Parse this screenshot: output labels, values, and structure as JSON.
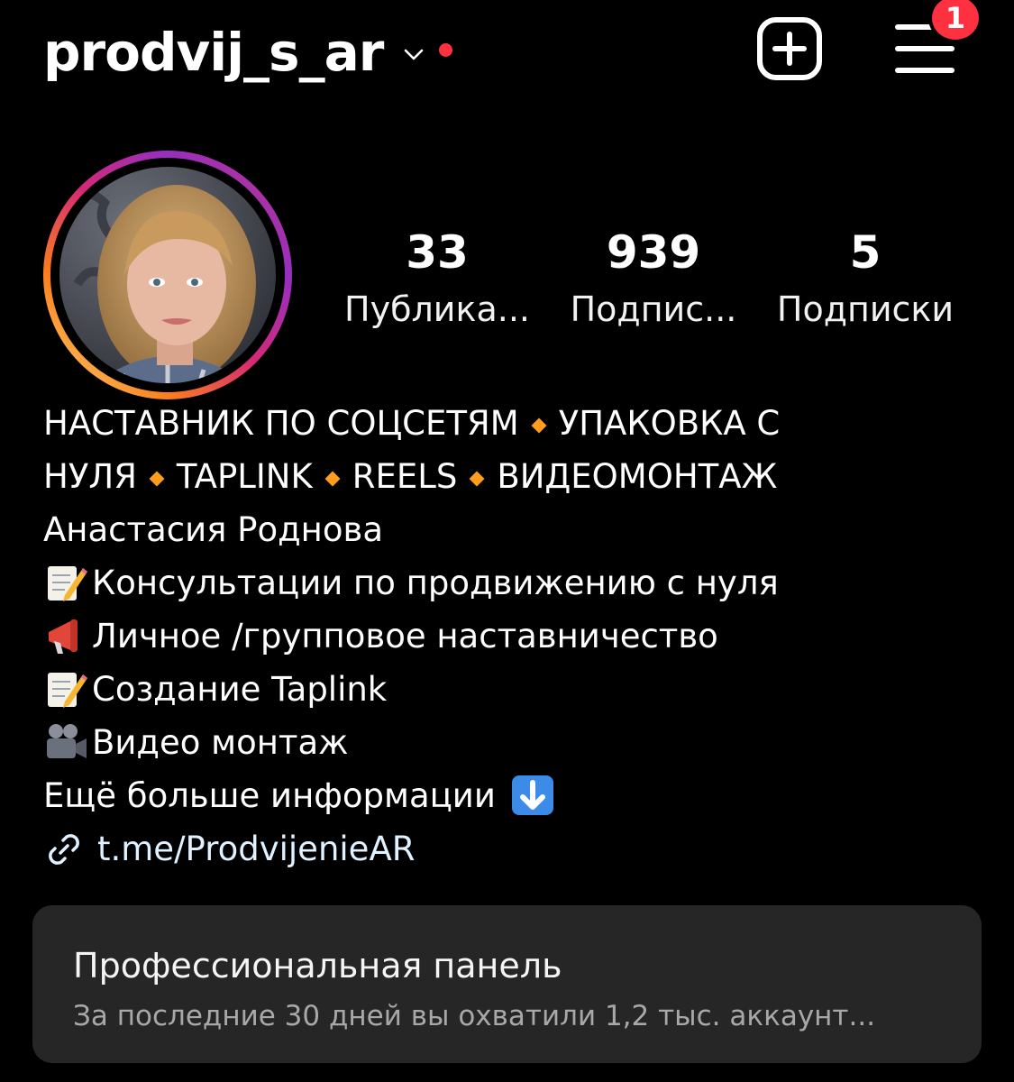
{
  "header": {
    "username": "prodvij_s_ar",
    "notification_count": "1",
    "icons": {
      "chevron": "chevron-down-icon",
      "create": "plus-square-icon",
      "menu": "hamburger-menu-icon"
    }
  },
  "profile": {
    "stats": [
      {
        "value": "33",
        "label": "Публика..."
      },
      {
        "value": "939",
        "label": "Подпис..."
      },
      {
        "value": "5",
        "label": "Подписки"
      }
    ]
  },
  "bio": {
    "headline_line1_parts": [
      "НАСТАВНИК ПО СОЦСЕТЯМ",
      "УПАКОВКА С"
    ],
    "headline_line2_parts": [
      "НУЛЯ",
      "TAPLINK",
      "REELS",
      "ВИДЕОМОНТАЖ"
    ],
    "name": "Анастасия Роднова",
    "items": [
      {
        "icon": "memo-pencil-emoji",
        "text": "Консультации по продвижению с нуля"
      },
      {
        "icon": "megaphone-emoji",
        "text": "Личное /групповое наставничество"
      },
      {
        "icon": "memo-pencil-emoji",
        "text": "Создание Taplink"
      },
      {
        "icon": "video-camera-emoji",
        "text": "Видео монтаж"
      }
    ],
    "more_info": "Ещё больше информации",
    "more_info_icon": "down-arrow-emoji",
    "link": "t.me/ProdvijenieAR",
    "link_icon": "link-icon"
  },
  "dashboard": {
    "title": "Профессиональная панель",
    "subtitle": "За последние 30 дней вы охватили 1,2 тыс. аккаунт..."
  },
  "colors": {
    "background": "#000000",
    "badge": "#ff3040",
    "diamond": "#ff9d1c",
    "panel": "#262626",
    "muted_text": "#a8a8a8"
  }
}
